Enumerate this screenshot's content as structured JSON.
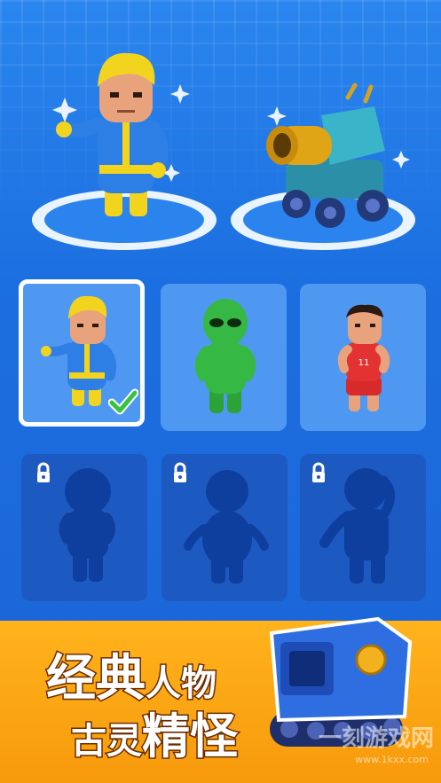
{
  "banner": {
    "line1_big": "经典",
    "line1_small": "人物",
    "line2_small": "古灵",
    "line2_big": "精怪"
  },
  "watermark": {
    "text": "一刻游戏网",
    "url": "www.1kxx.com"
  },
  "characters": [
    {
      "id": "vault-boy",
      "state": "unlocked",
      "selected": true
    },
    {
      "id": "green-alien",
      "state": "unlocked",
      "selected": false
    },
    {
      "id": "basketball-player",
      "state": "unlocked",
      "selected": false
    },
    {
      "id": "locked-1",
      "state": "locked",
      "selected": false
    },
    {
      "id": "locked-2",
      "state": "locked",
      "selected": false
    },
    {
      "id": "locked-3",
      "state": "locked",
      "selected": false
    }
  ],
  "jersey_number": "11",
  "colors": {
    "background": "#1f72e3",
    "card_unlocked": "#4f98f2",
    "card_locked": "#1c5ac2",
    "silhouette": "#0f3f9e",
    "banner": "#fcaa17",
    "check": "#37c23f"
  },
  "icons": {
    "selected": "checkmark-icon",
    "locked": "padlock-icon"
  }
}
